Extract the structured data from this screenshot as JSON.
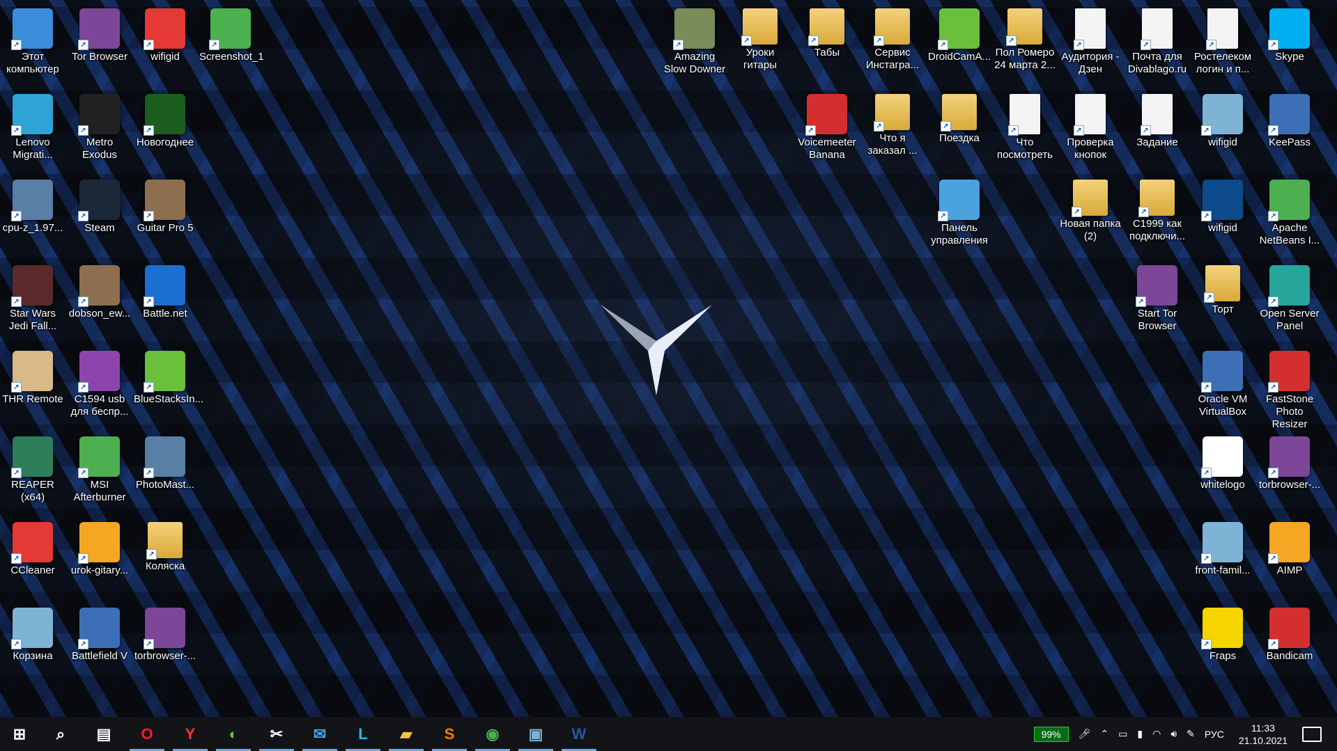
{
  "desktop": {
    "icons": [
      {
        "label": "Этот\nкомпьютер",
        "icon": "computer-icon",
        "color": "#3b8ddb"
      },
      {
        "label": "Tor Browser",
        "icon": "tor-browser-icon",
        "color": "#7d4698"
      },
      {
        "label": "wifigid",
        "icon": "pdf-file-icon",
        "color": "#e53935"
      },
      {
        "label": "Screenshot_1",
        "icon": "image-file-icon",
        "color": "#4caf50"
      },
      {
        "label": "Lenovo\nMigrati...",
        "icon": "lenovo-migration-icon",
        "color": "#2ea3d6"
      },
      {
        "label": "Metro Exodus",
        "icon": "metro-exodus-icon",
        "color": "#222222"
      },
      {
        "label": "Новогоднее",
        "icon": "wifigid-logo-icon",
        "color": "#1b5e20"
      },
      {
        "label": "cpu-z_1.97...",
        "icon": "cpu-z-icon",
        "color": "#5a7fa6"
      },
      {
        "label": "Steam",
        "icon": "steam-icon",
        "color": "#1b2838"
      },
      {
        "label": "Guitar Pro 5",
        "icon": "guitar-pro-icon",
        "color": "#8d6e4e"
      },
      {
        "label": "Star Wars\nJedi Fall...",
        "icon": "star-wars-icon",
        "color": "#5b2a2a"
      },
      {
        "label": "dobson_ew...",
        "icon": "guitar-pro-file-icon",
        "color": "#8d6e4e"
      },
      {
        "label": "Battle.net",
        "icon": "battlenet-icon",
        "color": "#1c6fd1"
      },
      {
        "label": "THR Remote",
        "icon": "yamaha-thr-icon",
        "color": "#d9b98a"
      },
      {
        "label": "C1594 usb\nдля беспр...",
        "icon": "winrar-icon",
        "color": "#8e44ad"
      },
      {
        "label": "BlueStacksIn...",
        "icon": "bluestacks-icon",
        "color": "#6abf3b"
      },
      {
        "label": "REAPER (x64)",
        "icon": "reaper-icon",
        "color": "#2e7d5b"
      },
      {
        "label": "MSI\nAfterburner",
        "icon": "msi-afterburner-icon",
        "color": "#4caf50"
      },
      {
        "label": "PhotoMast...",
        "icon": "photomaster-icon",
        "color": "#5a7fa6"
      },
      {
        "label": "CCleaner",
        "icon": "ccleaner-icon",
        "color": "#e53935"
      },
      {
        "label": "urok-gitary...",
        "icon": "audio-file-icon",
        "color": "#f5a623"
      },
      {
        "label": "Коляска",
        "icon": "zip-folder-icon",
        "color": "#d9a93a"
      },
      {
        "label": "Корзина",
        "icon": "recycle-bin-icon",
        "color": "#7fb3d5"
      },
      {
        "label": "Battlefield V",
        "icon": "battlefield-icon",
        "color": "#3d6fb6"
      },
      {
        "label": "torbrowser-...",
        "icon": "tor-onion-icon",
        "color": "#7d4698"
      },
      {
        "label": "Amazing\nSlow Downer",
        "icon": "amazing-slow-downer-icon",
        "color": "#7a8c5a"
      },
      {
        "label": "Уроки\nгитары",
        "icon": "folder-icon",
        "color": "#d9a93a"
      },
      {
        "label": "Табы",
        "icon": "folder-icon",
        "color": "#d9a93a"
      },
      {
        "label": "Сервис\nИнстагра...",
        "icon": "folder-icon",
        "color": "#d9a93a"
      },
      {
        "label": "DroidCamA...",
        "icon": "droidcam-icon",
        "color": "#6abf3b"
      },
      {
        "label": "Пол Ромеро\n24 марта 2...",
        "icon": "pdf-folder-icon",
        "color": "#d9a93a"
      },
      {
        "label": "Аудитория -\nДзен",
        "icon": "document-icon",
        "color": "#f4f4f4"
      },
      {
        "label": "Почта для\nDivablago.ru",
        "icon": "document-icon",
        "color": "#f4f4f4"
      },
      {
        "label": "Ростелеком\nлогин и п...",
        "icon": "document-icon",
        "color": "#f4f4f4"
      },
      {
        "label": "Skype",
        "icon": "skype-icon",
        "color": "#00aff0"
      },
      {
        "label": "Voicemeeter\nBanana",
        "icon": "voicemeeter-icon",
        "color": "#d32f2f"
      },
      {
        "label": "Что я\nзаказал ...",
        "icon": "folder-icon",
        "color": "#d9a93a"
      },
      {
        "label": "Поездка",
        "icon": "folder-icon",
        "color": "#d9a93a"
      },
      {
        "label": "Что\nпосмотреть",
        "icon": "document-icon",
        "color": "#f4f4f4"
      },
      {
        "label": "Проверка\nкнопок",
        "icon": "document-icon",
        "color": "#f4f4f4"
      },
      {
        "label": "Задание",
        "icon": "document-icon",
        "color": "#f4f4f4"
      },
      {
        "label": "wifigid",
        "icon": "wifigid-image-icon",
        "color": "#7fb3d5"
      },
      {
        "label": "KeePass",
        "icon": "keepass-icon",
        "color": "#3d6fb6"
      },
      {
        "label": "Панель\nуправления",
        "icon": "control-panel-icon",
        "color": "#4aa3df"
      },
      {
        "label": "Новая папка\n(2)",
        "icon": "folder-icon",
        "color": "#d9a93a"
      },
      {
        "label": "C1999 как\nподключи...",
        "icon": "folder-icon",
        "color": "#d9a93a"
      },
      {
        "label": "wifigid",
        "icon": "photoshop-file-icon",
        "color": "#0c4a8c"
      },
      {
        "label": "Apache\nNetBeans I...",
        "icon": "netbeans-icon",
        "color": "#4caf50"
      },
      {
        "label": "Start Tor\nBrowser",
        "icon": "tor-browser-icon",
        "color": "#7d4698"
      },
      {
        "label": "Торт",
        "icon": "pdf-folder-icon",
        "color": "#d9a93a"
      },
      {
        "label": "Open Server\nPanel",
        "icon": "open-server-icon",
        "color": "#26a69a"
      },
      {
        "label": "Oracle VM\nVirtualBox",
        "icon": "virtualbox-icon",
        "color": "#3d6fb6"
      },
      {
        "label": "FastStone\nPhoto Resizer",
        "icon": "faststone-icon",
        "color": "#d32f2f"
      },
      {
        "label": "whitelogo",
        "icon": "wifigid-logo-icon",
        "color": "#ffffff"
      },
      {
        "label": "torbrowser-...",
        "icon": "tor-onion-icon",
        "color": "#7d4698"
      },
      {
        "label": "front-famil...",
        "icon": "image-file-icon",
        "color": "#7fb3d5"
      },
      {
        "label": "AIMP",
        "icon": "aimp-icon",
        "color": "#f5a623"
      },
      {
        "label": "Fraps",
        "icon": "fraps-icon",
        "color": "#f5d400"
      },
      {
        "label": "Bandicam",
        "icon": "bandicam-icon",
        "color": "#d32f2f"
      }
    ]
  },
  "taskbar": {
    "apps": [
      {
        "name": "start-button",
        "glyph": "⊞"
      },
      {
        "name": "search-icon",
        "glyph": "⌕"
      },
      {
        "name": "task-view-icon",
        "glyph": "▤"
      },
      {
        "name": "opera-icon",
        "glyph": "O",
        "color": "#ff1b2d"
      },
      {
        "name": "yandex-browser-icon",
        "glyph": "Y",
        "color": "#ff3333"
      },
      {
        "name": "tor-taskbar-icon",
        "glyph": "◐",
        "color": "#6abf3b"
      },
      {
        "name": "snipping-tool-icon",
        "glyph": "✂",
        "color": "#ffffff"
      },
      {
        "name": "mail-icon",
        "glyph": "✉",
        "color": "#4aa3df"
      },
      {
        "name": "lenovo-vantage-icon",
        "glyph": "L",
        "color": "#29b6f6"
      },
      {
        "name": "file-explorer-icon",
        "glyph": "▰",
        "color": "#f3c24b"
      },
      {
        "name": "sublime-text-icon",
        "glyph": "S",
        "color": "#f57c00"
      },
      {
        "name": "chrome-icon",
        "glyph": "◉",
        "color": "#4caf50"
      },
      {
        "name": "control-panel-taskbar-icon",
        "glyph": "▣",
        "color": "#7fb3d5"
      },
      {
        "name": "word-icon",
        "glyph": "W",
        "color": "#2b579a"
      }
    ],
    "battery": "99%",
    "language": "РУС",
    "time": "11:33",
    "date": "21.10.2021"
  }
}
